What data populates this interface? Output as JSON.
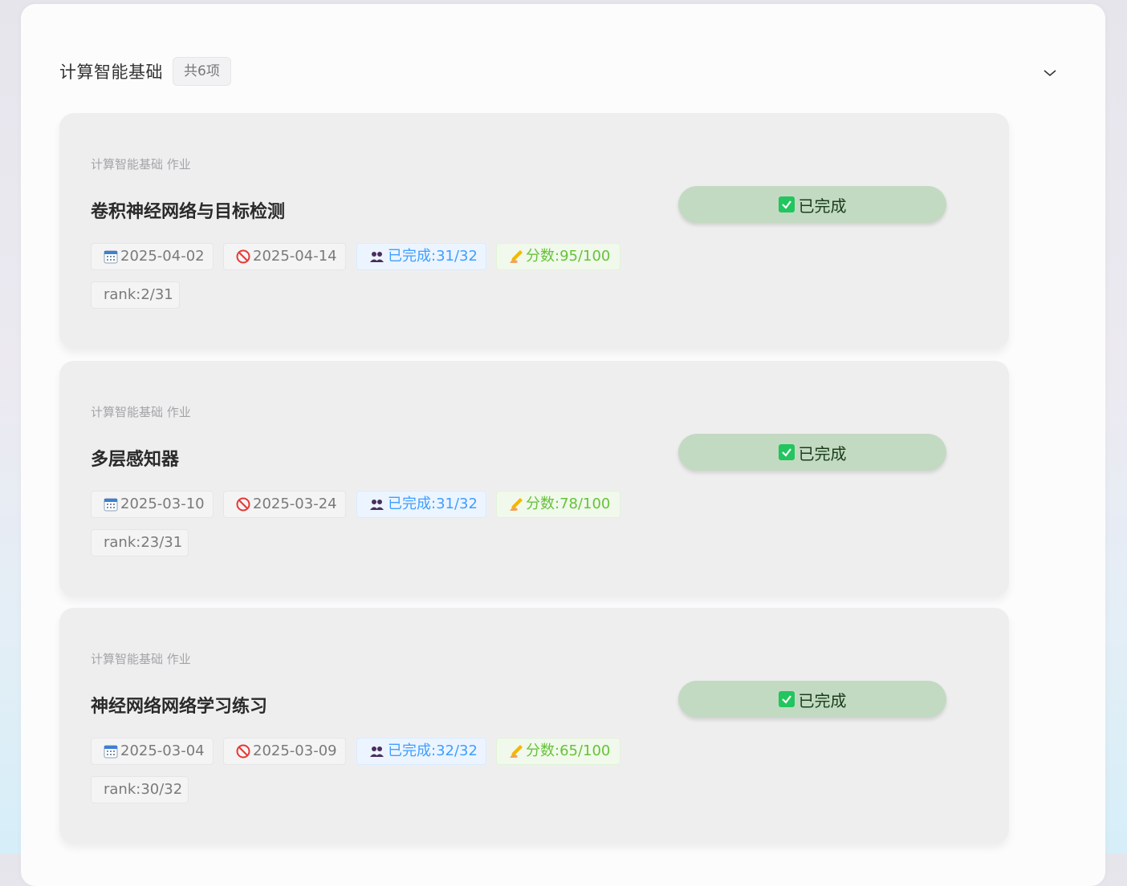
{
  "section": {
    "title": "计算智能基础",
    "count_label": "共6项",
    "toggle_icon": "chevron-down-icon"
  },
  "colors": {
    "card_bg": "#efeeef",
    "status_bg": "#c3dac2",
    "check_green": "#22c55e",
    "done_blue": "#409eff",
    "score_green": "#67c23a"
  },
  "assignments": [
    {
      "course": "计算智能基础 作业",
      "title": "卷积神经网络与目标检测",
      "start_date": "2025-04-02",
      "due_date": "2025-04-14",
      "completed": "已完成:31/32",
      "score": "分数:95/100",
      "rank": "rank:2/31",
      "status": "已完成"
    },
    {
      "course": "计算智能基础 作业",
      "title": "多层感知器",
      "start_date": "2025-03-10",
      "due_date": "2025-03-24",
      "completed": "已完成:31/32",
      "score": "分数:78/100",
      "rank": "rank:23/31",
      "status": "已完成"
    },
    {
      "course": "计算智能基础 作业",
      "title": "神经网络网络学习练习",
      "start_date": "2025-03-04",
      "due_date": "2025-03-09",
      "completed": "已完成:32/32",
      "score": "分数:65/100",
      "rank": "rank:30/32",
      "status": "已完成"
    }
  ]
}
